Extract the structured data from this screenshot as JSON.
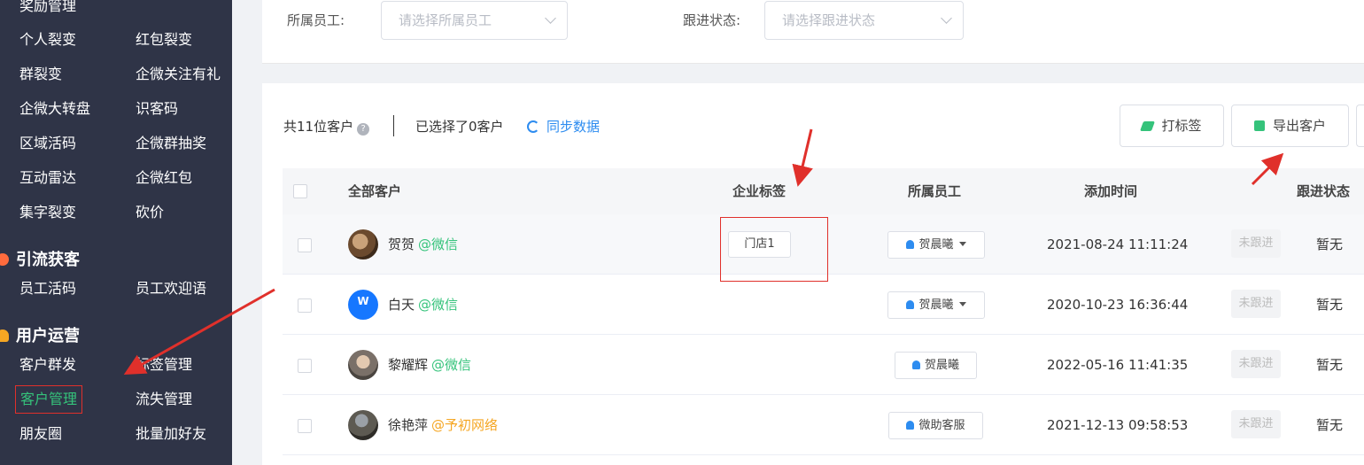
{
  "sidebar": {
    "top_partial": "奖励管理",
    "rows": [
      {
        "c1": "个人裂变",
        "c2": "红包裂变"
      },
      {
        "c1": "群裂变",
        "c2": "企微关注有礼"
      },
      {
        "c1": "企微大转盘",
        "c2": "识客码"
      },
      {
        "c1": "区域活码",
        "c2": "企微群抽奖"
      },
      {
        "c1": "互动雷达",
        "c2": "企微红包"
      },
      {
        "c1": "集字裂变",
        "c2": "砍价"
      }
    ],
    "section_traffic": "引流获客",
    "traffic_rows": [
      {
        "c1": "员工活码",
        "c2": "员工欢迎语"
      }
    ],
    "section_ops": "用户运营",
    "ops_rows": [
      {
        "c1": "客户群发",
        "c2": "标签管理"
      },
      {
        "c1": "客户管理",
        "c2": "流失管理"
      },
      {
        "c1": "朋友圈",
        "c2": "批量加好友"
      }
    ],
    "active_item": "客户管理"
  },
  "filters": {
    "staff_label": "所属员工:",
    "staff_placeholder": "请选择所属员工",
    "status_label": "跟进状态:",
    "status_placeholder": "请选择跟进状态"
  },
  "summary": {
    "total": "共11位客户",
    "selected": "已选择了0客户",
    "sync": "同步数据"
  },
  "buttons": {
    "tag": "打标签",
    "export": "导出客户"
  },
  "table": {
    "headers": {
      "customer": "全部客户",
      "tags": "企业标签",
      "staff": "所属员工",
      "added": "添加时间",
      "status": "跟进状态"
    },
    "rows": [
      {
        "name": "贺贺",
        "source": "@微信",
        "source_color": "#35c37b",
        "tag": "门店1",
        "staff": "贺晨曦",
        "staff_dropdown": true,
        "time": "2021-08-24 11:11:24",
        "status": "未跟进",
        "note": "暂无"
      },
      {
        "name": "白天",
        "source": "@微信",
        "source_color": "#35c37b",
        "tag": "",
        "staff": "贺晨曦",
        "staff_dropdown": true,
        "time": "2020-10-23 16:36:44",
        "status": "未跟进",
        "note": "暂无"
      },
      {
        "name": "黎耀辉",
        "source": "@微信",
        "source_color": "#35c37b",
        "tag": "",
        "staff": "贺晨曦",
        "staff_dropdown": false,
        "time": "2022-05-16 11:41:35",
        "status": "未跟进",
        "note": "暂无"
      },
      {
        "name": "徐艳萍",
        "source": "@予初网络",
        "source_color": "#f5a623",
        "tag": "",
        "staff": "微助客服",
        "staff_dropdown": false,
        "time": "2021-12-13 09:58:53",
        "status": "未跟进",
        "note": "暂无"
      }
    ]
  },
  "colors": {
    "sidebar_bg": "#2f3447",
    "accent_green": "#35c37b",
    "accent_blue": "#2d8cf0",
    "annotation_red": "#e0302b"
  }
}
